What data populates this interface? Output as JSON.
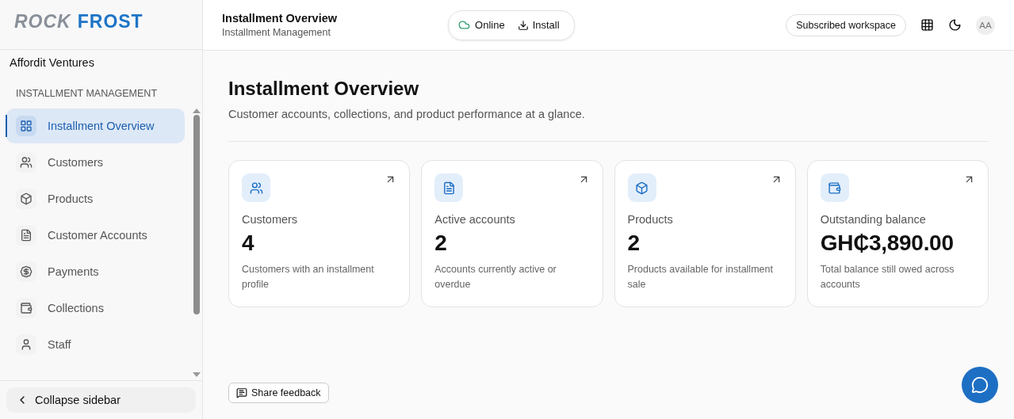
{
  "logo": {
    "part_1": "ROCK",
    "part_2": "FROST"
  },
  "sidebar": {
    "workspace": "Affordit Ventures",
    "section": "INSTALLMENT MANAGEMENT",
    "items": [
      {
        "label": "Installment Overview",
        "kind": "overview",
        "selected": true
      },
      {
        "label": "Customers",
        "kind": "customers",
        "selected": false
      },
      {
        "label": "Products",
        "kind": "products",
        "selected": false
      },
      {
        "label": "Customer Accounts",
        "kind": "accounts",
        "selected": false
      },
      {
        "label": "Payments",
        "kind": "payments",
        "selected": false
      },
      {
        "label": "Collections",
        "kind": "collections",
        "selected": false
      },
      {
        "label": "Staff",
        "kind": "staff",
        "selected": false
      }
    ],
    "collapse": "Collapse sidebar"
  },
  "header": {
    "title": "Installment Overview",
    "subtitle": "Installment Management",
    "status": "Online",
    "install": "Install",
    "workspace_badge": "Subscribed workspace",
    "avatar": "AA"
  },
  "page": {
    "title": "Installment Overview",
    "subtitle": "Customer accounts, collections, and product performance at a glance.",
    "cards": [
      {
        "kind": "customers",
        "label": "Customers",
        "value": "4",
        "description": "Customers with an installment profile"
      },
      {
        "kind": "accounts",
        "label": "Active accounts",
        "value": "2",
        "description": "Accounts currently active or overdue"
      },
      {
        "kind": "products",
        "label": "Products",
        "value": "2",
        "description": "Products available for installment sale"
      },
      {
        "kind": "collections",
        "label": "Outstanding balance",
        "value": "GH₵3,890.00",
        "description": "Total balance still owed across accounts"
      }
    ],
    "feedback": "Share feedback"
  }
}
